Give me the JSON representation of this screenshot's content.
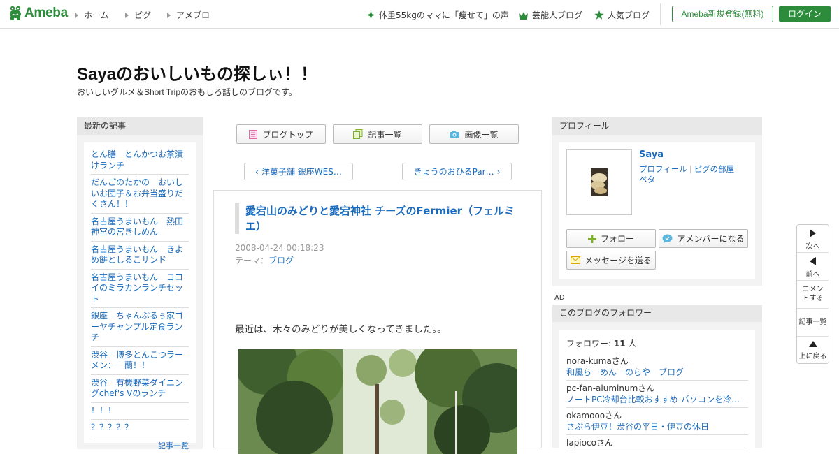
{
  "header": {
    "brand": "Ameba",
    "nav": [
      "ホーム",
      "ピグ",
      "アメブロ"
    ],
    "links": [
      {
        "label": "体重55kgのママに「痩せて」の声",
        "icon": "green-sparkle-icon"
      },
      {
        "label": "芸能人ブログ",
        "icon": "crown-icon"
      },
      {
        "label": "人気ブログ",
        "icon": "star-icon"
      }
    ],
    "register_label": "Ameba新規登録(無料)",
    "login_label": "ログイン"
  },
  "blog": {
    "title": "Sayaのおいしいもの探しぃ！！",
    "description": "おいしいグルメ＆Short Tripのおもしろ話しのブログです。"
  },
  "sidebar_left": {
    "heading": "最新の記事",
    "items": [
      "とん膳　とんかつお茶漬けランチ",
      "だんごのたかの　おいしいお団子＆お弁当盛りだくさん！！",
      "名古屋うまいもん　熱田神宮の宮きしめん",
      "名古屋うまいもん　きよめ餅としるこサンド",
      "名古屋うまいもん　ヨコイのミラカンランチセット",
      "銀座　ちゃんぷるぅ家ゴーヤチャンプル定食ランチ",
      "渋谷　博多とんこつラーメン：一蘭！！",
      "渋谷　有機野菜ダイニングchef's Vのランチ",
      "！！！",
      "？？？？？"
    ],
    "more_label": "記事一覧"
  },
  "toolbar": {
    "blog_top": "ブログトップ",
    "article_list": "記事一覧",
    "image_list": "画像一覧"
  },
  "pager": {
    "prev": "洋菓子舗 銀座WES…",
    "next": "きょうのおひるPar…"
  },
  "article": {
    "title": "愛宕山のみどりと愛宕神社 チーズのFermier（フェルミエ）",
    "date": "2008-04-24 00:18:23",
    "theme_label": "テーマ：",
    "theme": "ブログ",
    "body": "最近は、木々のみどりが美しくなってきました。。"
  },
  "profile": {
    "heading": "プロフィール",
    "name": "Saya",
    "link_profile": "プロフィール",
    "link_pig": "ピグの部屋",
    "link_peta": "ペタ",
    "follow": "フォロー",
    "amember": "アメンバーになる",
    "message": "メッセージを送る"
  },
  "ad_label": "AD",
  "followers": {
    "heading": "このブログのフォロワー",
    "count_label": "フォロワー:",
    "count": "11",
    "count_unit": "人",
    "items": [
      {
        "user": "nora-kumaさん",
        "blog": "和風らーめん　のらや　ブログ"
      },
      {
        "user": "pc-fan-aluminumさん",
        "blog": "ノートPC冷却台比較おすすめ-パソコンを冷…"
      },
      {
        "user": "okamoooさん",
        "blog": "さぷら伊豆！渋谷の平日・伊豆の休日"
      },
      {
        "user": "lapiocoさん",
        "blog": ""
      }
    ]
  },
  "float_nav": {
    "next": "次へ",
    "prev": "前へ",
    "comment": "コメントする",
    "list": "記事一覧",
    "top": "上に戻る"
  }
}
